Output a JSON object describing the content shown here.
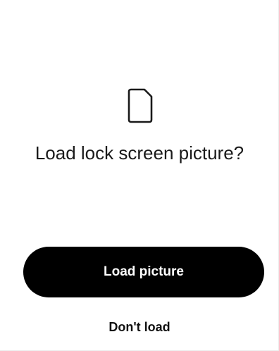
{
  "dialog": {
    "icon": "sd-card-icon",
    "title": "Load lock screen picture?",
    "primary_button_label": "Load picture",
    "secondary_button_label": "Don't load"
  },
  "colors": {
    "background": "#ffffff",
    "primary_button_bg": "#000000",
    "primary_button_text": "#ffffff",
    "text": "#1a1a1a"
  }
}
